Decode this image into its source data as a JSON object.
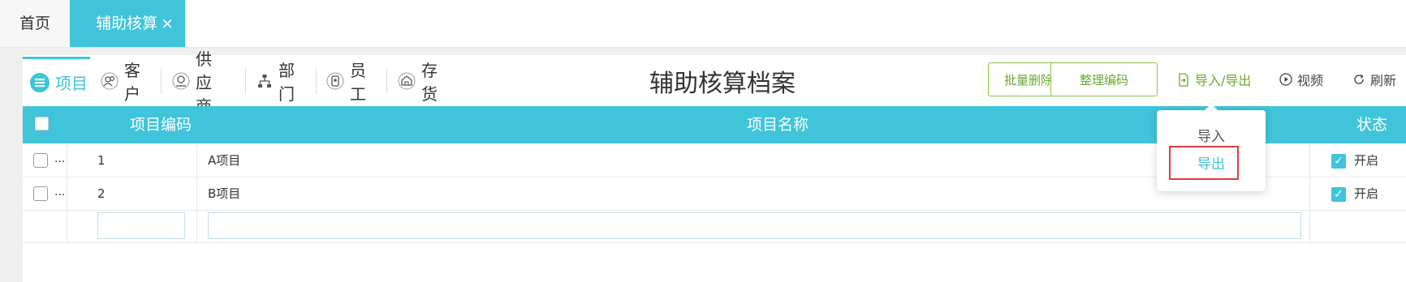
{
  "tabs": {
    "home": "首页",
    "active": "辅助核算",
    "close": "×"
  },
  "categories": [
    {
      "label": "项目",
      "icon": "list-icon",
      "active": true
    },
    {
      "label": "客户",
      "icon": "users-icon",
      "active": false
    },
    {
      "label": "供应商",
      "icon": "supplier-icon",
      "active": false
    },
    {
      "label": "部门",
      "icon": "org-chart-icon",
      "active": false
    },
    {
      "label": "员工",
      "icon": "badge-icon",
      "active": false
    },
    {
      "label": "存货",
      "icon": "warehouse-icon",
      "active": false
    }
  ],
  "page_title": "辅助核算档案",
  "toolbar": {
    "batch_delete": "批量删除",
    "sort_codes": "整理编码",
    "import_export": "导入/导出",
    "video": "视频",
    "refresh": "刷新"
  },
  "table": {
    "headers": {
      "code": "项目编码",
      "name": "项目名称",
      "status": "状态"
    },
    "rows": [
      {
        "more": "...",
        "code": "1",
        "name": "A项目",
        "enabled": true,
        "status": "开启"
      },
      {
        "more": "...",
        "code": "2",
        "name": "B项目",
        "enabled": true,
        "status": "开启"
      }
    ],
    "new_row": {
      "code": "",
      "name": ""
    }
  },
  "dropdown": {
    "import": "导入",
    "export": "导出"
  },
  "colors": {
    "accent": "#40c4d9",
    "green": "#8bc34a",
    "highlight": "#e23b3b"
  }
}
